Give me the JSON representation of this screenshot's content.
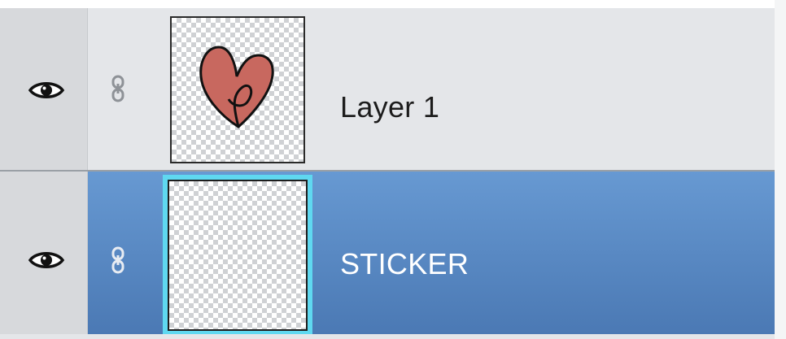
{
  "layers_panel": {
    "layers": [
      {
        "name": "Layer 1",
        "visible_icon": "eye-icon",
        "link_icon": "chain-link-icon",
        "thumbnail": "heart-drawing",
        "selected": false
      },
      {
        "name": "STICKER",
        "visible_icon": "eye-icon",
        "link_icon": "chain-link-icon",
        "thumbnail": "empty-transparent",
        "selected": true
      }
    ]
  },
  "colors": {
    "panel_background": "#e4e6e9",
    "selected_row": "#5a8ac6",
    "selected_thumb_border": "#5fd8f0",
    "heart_fill": "#c8685f"
  }
}
